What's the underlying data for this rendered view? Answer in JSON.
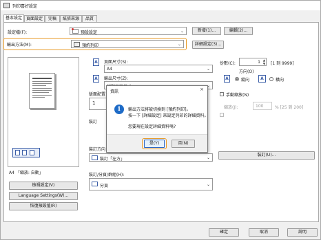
{
  "window": {
    "title": "列印喜好設定"
  },
  "tabs": [
    {
      "label": "基本設定"
    },
    {
      "label": "頁面設定"
    },
    {
      "label": "完稿"
    },
    {
      "label": "紙張來源"
    },
    {
      "label": "品質"
    }
  ],
  "profile": {
    "label": "設定檔(F):",
    "value": "預設設定",
    "add_label": "新增(1)...",
    "edit_label": "編輯(2)..."
  },
  "output": {
    "label": "輸出方法(M):",
    "value": "預約列印",
    "details_label": "詳細設定(3)..."
  },
  "page_size": {
    "label": "頁面尺寸(S):",
    "value": "A4"
  },
  "output_size": {
    "label": "輸出尺寸(Z):",
    "value": "相配頁面尺寸"
  },
  "copies": {
    "label": "份數(C):",
    "value": "1",
    "range": "[1 到 9999]"
  },
  "orientation": {
    "label": "方向(O)",
    "portrait": "縱向",
    "landscape": "橫向"
  },
  "layout_label": "版面配置",
  "manual_scale_label": "手動縮放(N)",
  "scale": {
    "label": "縮放(J):",
    "value": "100",
    "range": "% [25 到 200]"
  },
  "binding_label": "裝訂",
  "binding_pos_label": "裝訂方向",
  "binding_combo": {
    "value": "裝訂「左方」"
  },
  "binding_button_label": "裝訂(U)...",
  "sort": {
    "label": "裝訂/分頁/群組(H):",
    "value": "分頁"
  },
  "preview": {
    "caption": "A4 「縮放: 自動」"
  },
  "left_buttons": {
    "view_label": "檢視設定(V)",
    "lang_label": "Language Settings(W)...",
    "restore_label": "恢復預設值(R)"
  },
  "bottom_buttons": {
    "ok": "確定",
    "cancel": "取消",
    "help": "說明"
  },
  "dialog": {
    "title": "資訊",
    "line1": "輸出方法將被切換到 [預約列印]。",
    "line2": "按一下 [詳細設定] 來設定列印的詳細資料。",
    "line3": "您要現在設定詳細資料嗎?",
    "yes_label": "是(Y)",
    "no_label": "否(N)"
  }
}
